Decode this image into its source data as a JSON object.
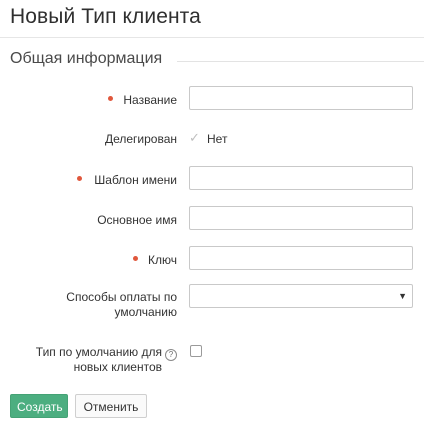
{
  "page": {
    "title": "Новый Тип клиента"
  },
  "section": {
    "title": "Общая информация"
  },
  "form": {
    "name": {
      "label": "Название",
      "value": "",
      "required": true
    },
    "delegated": {
      "label": "Делегирован",
      "value": "Нет",
      "icon": "check-icon"
    },
    "name_template": {
      "label": "Шаблон имени",
      "value": "",
      "required": true
    },
    "main_name": {
      "label": "Основное имя",
      "value": ""
    },
    "key": {
      "label": "Ключ",
      "value": "",
      "required": true
    },
    "payment_methods": {
      "label_line1": "Способы оплаты по",
      "label_line2": "умолчанию",
      "value": ""
    },
    "default_type": {
      "label_line1": "Тип по умолчанию для",
      "label_line2": "новых клиентов",
      "help": "?",
      "checked": false
    }
  },
  "buttons": {
    "create": "Создать",
    "cancel": "Отменить"
  },
  "colors": {
    "primary": "#4cae80",
    "required_dot": "#e0573c"
  }
}
